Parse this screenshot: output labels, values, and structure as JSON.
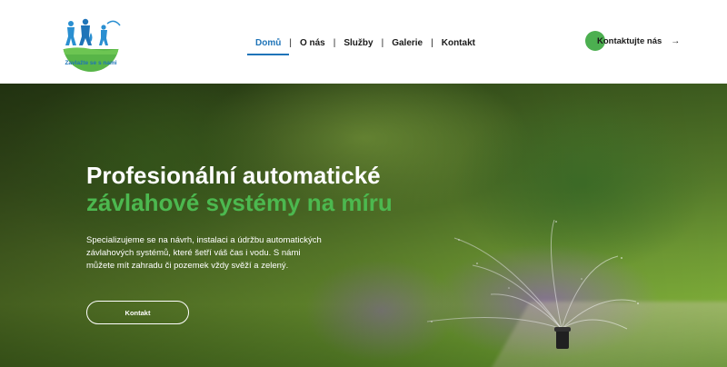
{
  "brand": {
    "logo_text": "Zavlažte se s nami",
    "accent_green": "#4caf50",
    "accent_blue": "#1f74b8"
  },
  "nav": {
    "items": [
      {
        "label": "Domů",
        "active": true
      },
      {
        "label": "O nás",
        "active": false
      },
      {
        "label": "Služby",
        "active": false
      },
      {
        "label": "Galerie",
        "active": false
      },
      {
        "label": "Kontakt",
        "active": false
      }
    ],
    "separator": "|"
  },
  "header_cta": {
    "label": "Kontaktujte nás",
    "arrow_icon": "arrow-right-icon",
    "arrow_glyph": "→"
  },
  "hero": {
    "title_line1": "Profesionální automatické",
    "title_line2": "závlahové systémy na míru",
    "description": "Specializujeme se na návrh, instalaci a údržbu automatických závlahových systémů, které šetří váš čas i vodu. S námi můžete mít zahradu či pozemek vždy svěží a zelený.",
    "button_label": "Kontakt"
  }
}
